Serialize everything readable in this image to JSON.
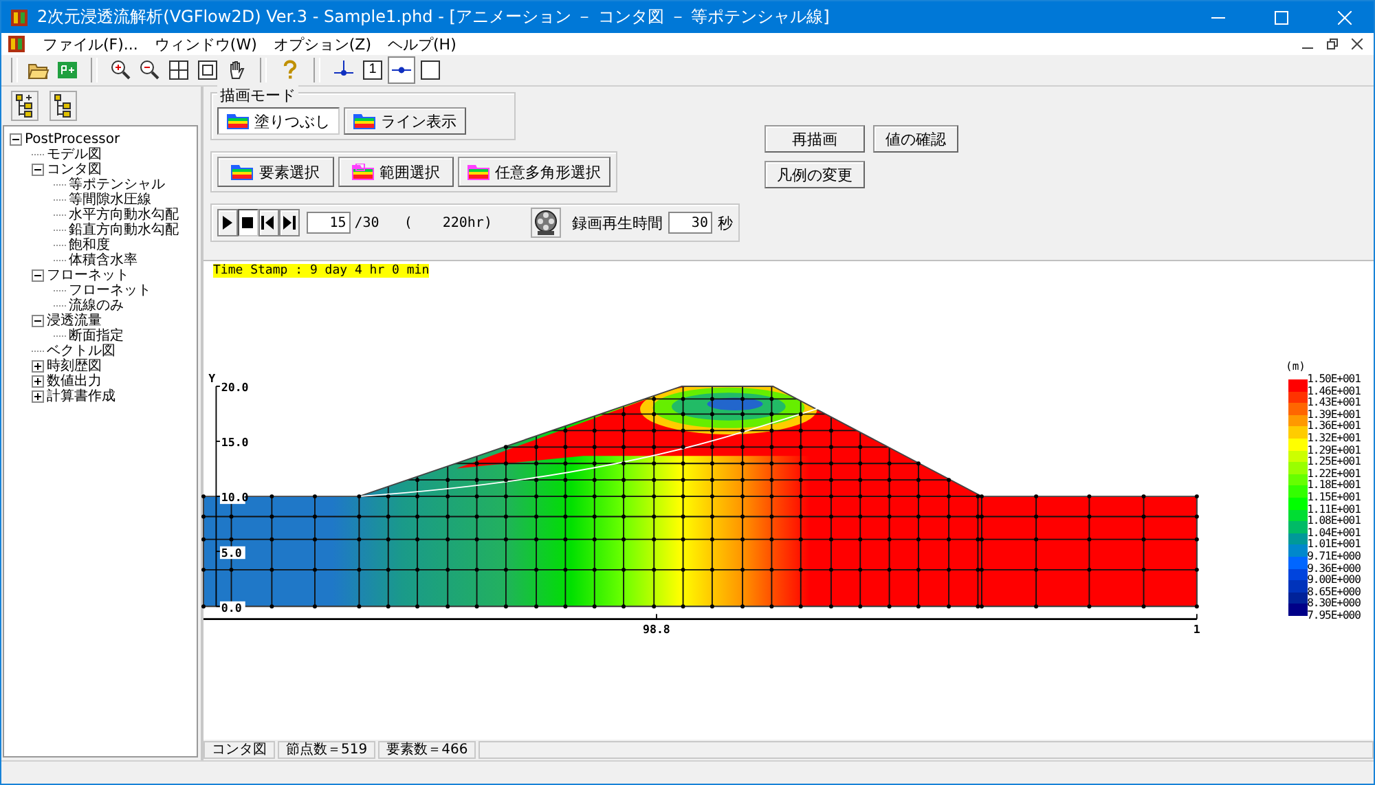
{
  "window": {
    "title": "2次元浸透流解析(VGFlow2D) Ver.3 - Sample1.phd - [アニメーション － コンタ図 － 等ポテンシャル線]"
  },
  "menu": [
    "ファイル(F)...",
    "ウィンドウ(W)",
    "オプション(Z)",
    "ヘルプ(H)"
  ],
  "toolbar": [
    {
      "kind": "open"
    },
    {
      "kind": "export"
    },
    {
      "kind": "separator"
    },
    {
      "kind": "zoom-in"
    },
    {
      "kind": "zoom-out"
    },
    {
      "kind": "fit"
    },
    {
      "kind": "frame"
    },
    {
      "kind": "hand"
    },
    {
      "kind": "separator"
    },
    {
      "kind": "help"
    },
    {
      "kind": "separator"
    },
    {
      "kind": "node-line",
      "selected": false
    },
    {
      "kind": "number",
      "label": "1",
      "selected": false
    },
    {
      "kind": "node-dot",
      "selected": true
    },
    {
      "kind": "blank",
      "selected": false
    }
  ],
  "side_toolbar": [
    {
      "kind": "expand"
    },
    {
      "kind": "collapse"
    }
  ],
  "tree": [
    {
      "label": "PostProcessor",
      "expanded": true,
      "children": [
        {
          "label": "モデル図"
        },
        {
          "label": "コンタ図",
          "expanded": true,
          "children": [
            {
              "label": "等ポテンシャル"
            },
            {
              "label": "等間隙水圧線"
            },
            {
              "label": "水平方向動水勾配"
            },
            {
              "label": "鉛直方向動水勾配"
            },
            {
              "label": "飽和度"
            },
            {
              "label": "体積含水率"
            }
          ]
        },
        {
          "label": "フローネット",
          "expanded": true,
          "children": [
            {
              "label": "フローネット"
            },
            {
              "label": "流線のみ"
            }
          ]
        },
        {
          "label": "浸透流量",
          "expanded": true,
          "children": [
            {
              "label": "断面指定"
            }
          ]
        },
        {
          "label": "ベクトル図"
        },
        {
          "label": "時刻歴図",
          "expanded": false
        },
        {
          "label": "数値出力",
          "expanded": false
        },
        {
          "label": "計算書作成",
          "expanded": false
        }
      ]
    }
  ],
  "draw_mode": {
    "title": "描画モード",
    "buttons": [
      {
        "label": "塗りつぶし",
        "selected": true
      },
      {
        "label": "ライン表示",
        "selected": false
      }
    ]
  },
  "selection_buttons": [
    {
      "label": "要素選択",
      "kind": "element"
    },
    {
      "label": "範囲選択",
      "kind": "range"
    },
    {
      "label": "任意多角形選択",
      "kind": "polygon"
    }
  ],
  "action_buttons": [
    "再描画",
    "値の確認",
    "凡例の変更"
  ],
  "player": {
    "controls": [
      {
        "kind": "play",
        "selected": false
      },
      {
        "kind": "stop",
        "selected": true
      },
      {
        "kind": "step-back",
        "selected": false
      },
      {
        "kind": "step-forward",
        "selected": false
      }
    ],
    "frame": "15",
    "total": "/30",
    "open_paren": "(",
    "hours": "220hr)",
    "record_label": "録画再生時間",
    "record_seconds": "30",
    "seconds_unit": "秒"
  },
  "time_stamp": "Time Stamp : 9 day 4 hr 0 min",
  "plot": {
    "y_axis_label": "Y",
    "y_ticks": [
      "20.0",
      "15.0",
      "10.0",
      "5.0",
      "0.0"
    ],
    "x_ticks": [
      "98.8",
      "1"
    ],
    "unit": "(m)",
    "legend_bands": [
      {
        "color": "#ff0000"
      },
      {
        "color": "#ff3300"
      },
      {
        "color": "#ff6600"
      },
      {
        "color": "#ff9900"
      },
      {
        "color": "#ffcc00"
      },
      {
        "color": "#ffff00"
      },
      {
        "color": "#ccff00"
      },
      {
        "color": "#99ff00"
      },
      {
        "color": "#66ff00"
      },
      {
        "color": "#33ff00"
      },
      {
        "color": "#00ff00"
      },
      {
        "color": "#00dd33"
      },
      {
        "color": "#00bb66"
      },
      {
        "color": "#009999"
      },
      {
        "color": "#0088cc"
      },
      {
        "color": "#0066ff"
      },
      {
        "color": "#0044dd"
      },
      {
        "color": "#0033bb"
      },
      {
        "color": "#002299"
      },
      {
        "color": "#000088"
      }
    ],
    "legend_labels": [
      "1.50E+001",
      "1.46E+001",
      "1.43E+001",
      "1.39E+001",
      "1.36E+001",
      "1.32E+001",
      "1.29E+001",
      "1.25E+001",
      "1.22E+001",
      "1.18E+001",
      "1.15E+001",
      "1.11E+001",
      "1.08E+001",
      "1.04E+001",
      "1.01E+001",
      "9.71E+000",
      "9.36E+000",
      "9.00E+000",
      "8.65E+000",
      "8.30E+000",
      "7.95E+000"
    ]
  },
  "status_bar": [
    "コンタ図",
    "節点数＝519",
    "要素数＝466"
  ]
}
